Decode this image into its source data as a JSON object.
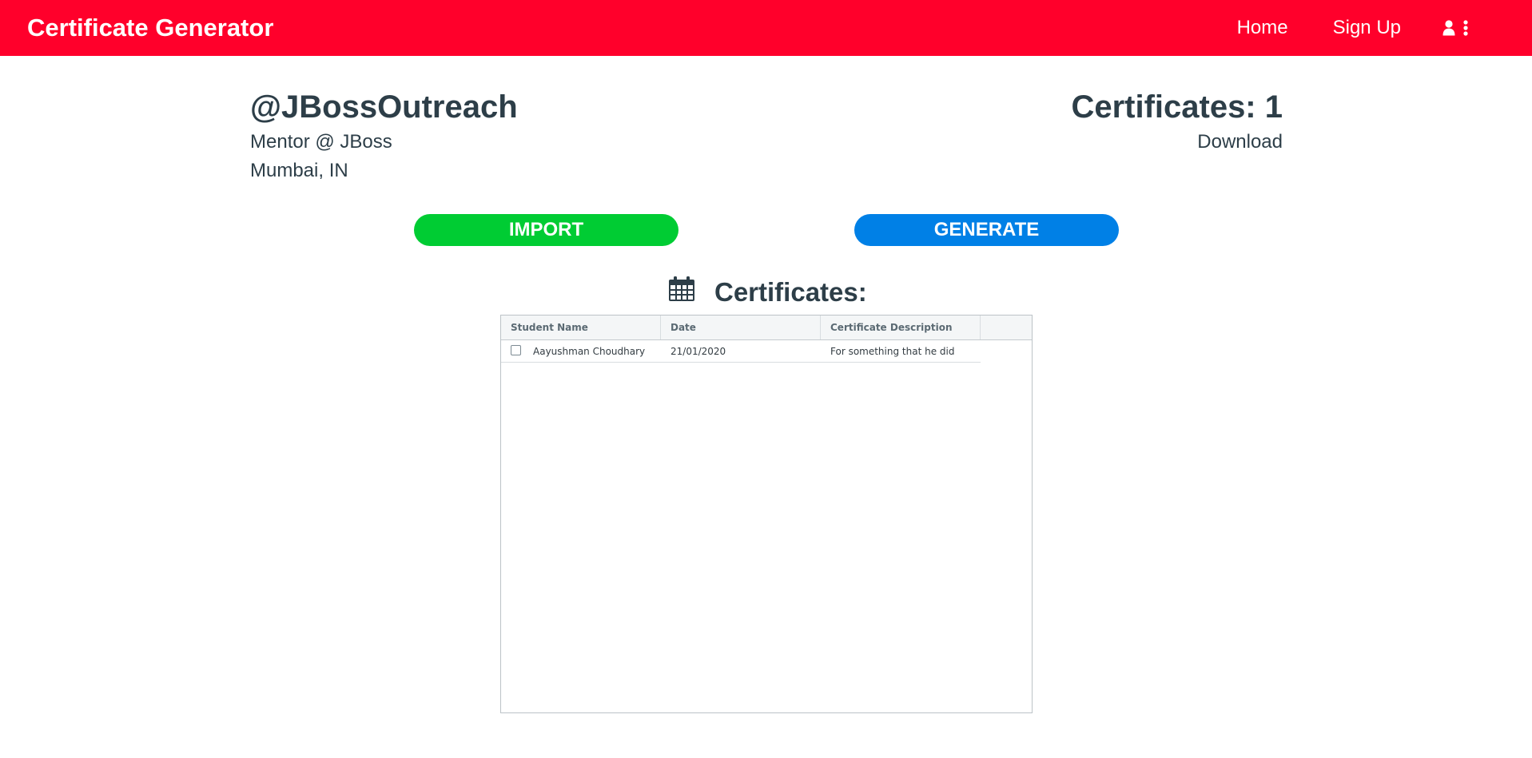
{
  "navbar": {
    "brand": "Certificate Generator",
    "links": [
      "Home",
      "Sign Up"
    ],
    "icons": [
      "user-icon",
      "more-vertical-icon"
    ],
    "background": "#ff002b"
  },
  "profile": {
    "handle": "@JBossOutreach",
    "role": "Mentor @ JBoss",
    "location": "Mumbai, IN"
  },
  "stats": {
    "count_label": "Certificates: 1",
    "download_label": "Download"
  },
  "actions": {
    "import_label": "IMPORT",
    "generate_label": "GENERATE",
    "import_color": "#00cc33",
    "generate_color": "#0080e6"
  },
  "certificates": {
    "title": "Certificates:",
    "icon": "calendar-icon",
    "columns": [
      "Student Name",
      "Date",
      "Certificate Description"
    ],
    "rows": [
      {
        "student_name": "Aayushman Choudhary",
        "date": "21/01/2020",
        "description": "For something that he did",
        "checked": false
      }
    ]
  }
}
